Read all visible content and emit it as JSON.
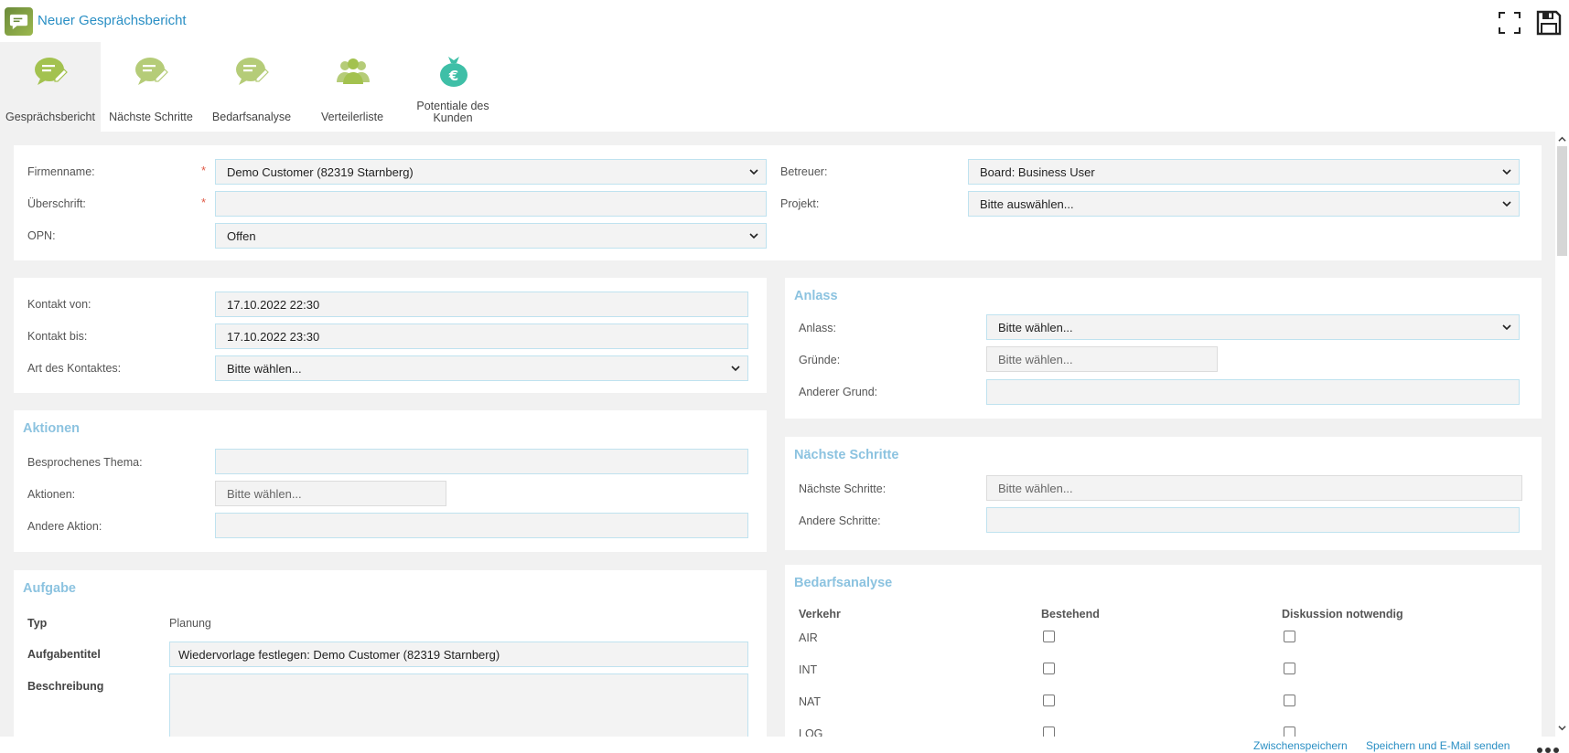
{
  "header": {
    "title": "Neuer Gesprächsbericht",
    "fullscreen_icon": "fullscreen-icon",
    "save_icon": "floppy-disk-icon"
  },
  "tabs": [
    {
      "label": "Gesprächsbericht",
      "icon": "chat-edit-icon",
      "active": true
    },
    {
      "label": "Nächste Schritte",
      "icon": "chat-edit-icon",
      "active": false
    },
    {
      "label": "Bedarfsanalyse",
      "icon": "chat-edit-icon",
      "active": false
    },
    {
      "label": "Verteilerliste",
      "icon": "people-group-icon",
      "active": false
    },
    {
      "label": "Potentiale des Kunden",
      "icon": "money-bag-euro-icon",
      "active": false
    }
  ],
  "general": {
    "firmenname_label": "Firmenname:",
    "firmenname_value": "Demo Customer (82319 Starnberg)",
    "ueberschrift_label": "Überschrift:",
    "ueberschrift_value": "",
    "opn_label": "OPN:",
    "opn_value": "Offen",
    "betreuer_label": "Betreuer:",
    "betreuer_value": "Board: Business User",
    "projekt_label": "Projekt:",
    "projekt_value": "Bitte auswählen...",
    "required_mark": "*"
  },
  "kontakt": {
    "von_label": "Kontakt von:",
    "von_value": "17.10.2022 22:30",
    "bis_label": "Kontakt bis:",
    "bis_value": "17.10.2022 23:30",
    "art_label": "Art des Kontaktes:",
    "art_value": "Bitte wählen..."
  },
  "anlass": {
    "title": "Anlass",
    "anlass_label": "Anlass:",
    "anlass_value": "Bitte wählen...",
    "gruende_label": "Gründe:",
    "gruende_placeholder": "Bitte wählen...",
    "anderer_grund_label": "Anderer Grund:",
    "anderer_grund_value": ""
  },
  "aktionen": {
    "title": "Aktionen",
    "thema_label": "Besprochenes Thema:",
    "thema_value": "",
    "aktionen_label": "Aktionen:",
    "aktionen_placeholder": "Bitte wählen...",
    "andere_label": "Andere Aktion:",
    "andere_value": ""
  },
  "naechste_schritte": {
    "title": "Nächste Schritte",
    "schritte_label": "Nächste Schritte:",
    "schritte_placeholder": "Bitte wählen...",
    "andere_label": "Andere Schritte:",
    "andere_value": ""
  },
  "aufgabe": {
    "title": "Aufgabe",
    "typ_label": "Typ",
    "typ_value": "Planung",
    "titel_label": "Aufgabentitel",
    "titel_value": "Wiedervorlage festlegen: Demo Customer (82319 Starnberg)",
    "beschreibung_label": "Beschreibung",
    "beschreibung_value": ""
  },
  "bedarfsanalyse": {
    "title": "Bedarfsanalyse",
    "col_verkehr": "Verkehr",
    "col_bestehend": "Bestehend",
    "col_diskussion": "Diskussion notwendig",
    "rows": [
      "AIR",
      "INT",
      "NAT",
      "LOG"
    ]
  },
  "footer": {
    "zwischenspeichern": "Zwischenspeichern",
    "speichern_email": "Speichern und E-Mail senden",
    "more_icon": "more-dots-icon"
  }
}
